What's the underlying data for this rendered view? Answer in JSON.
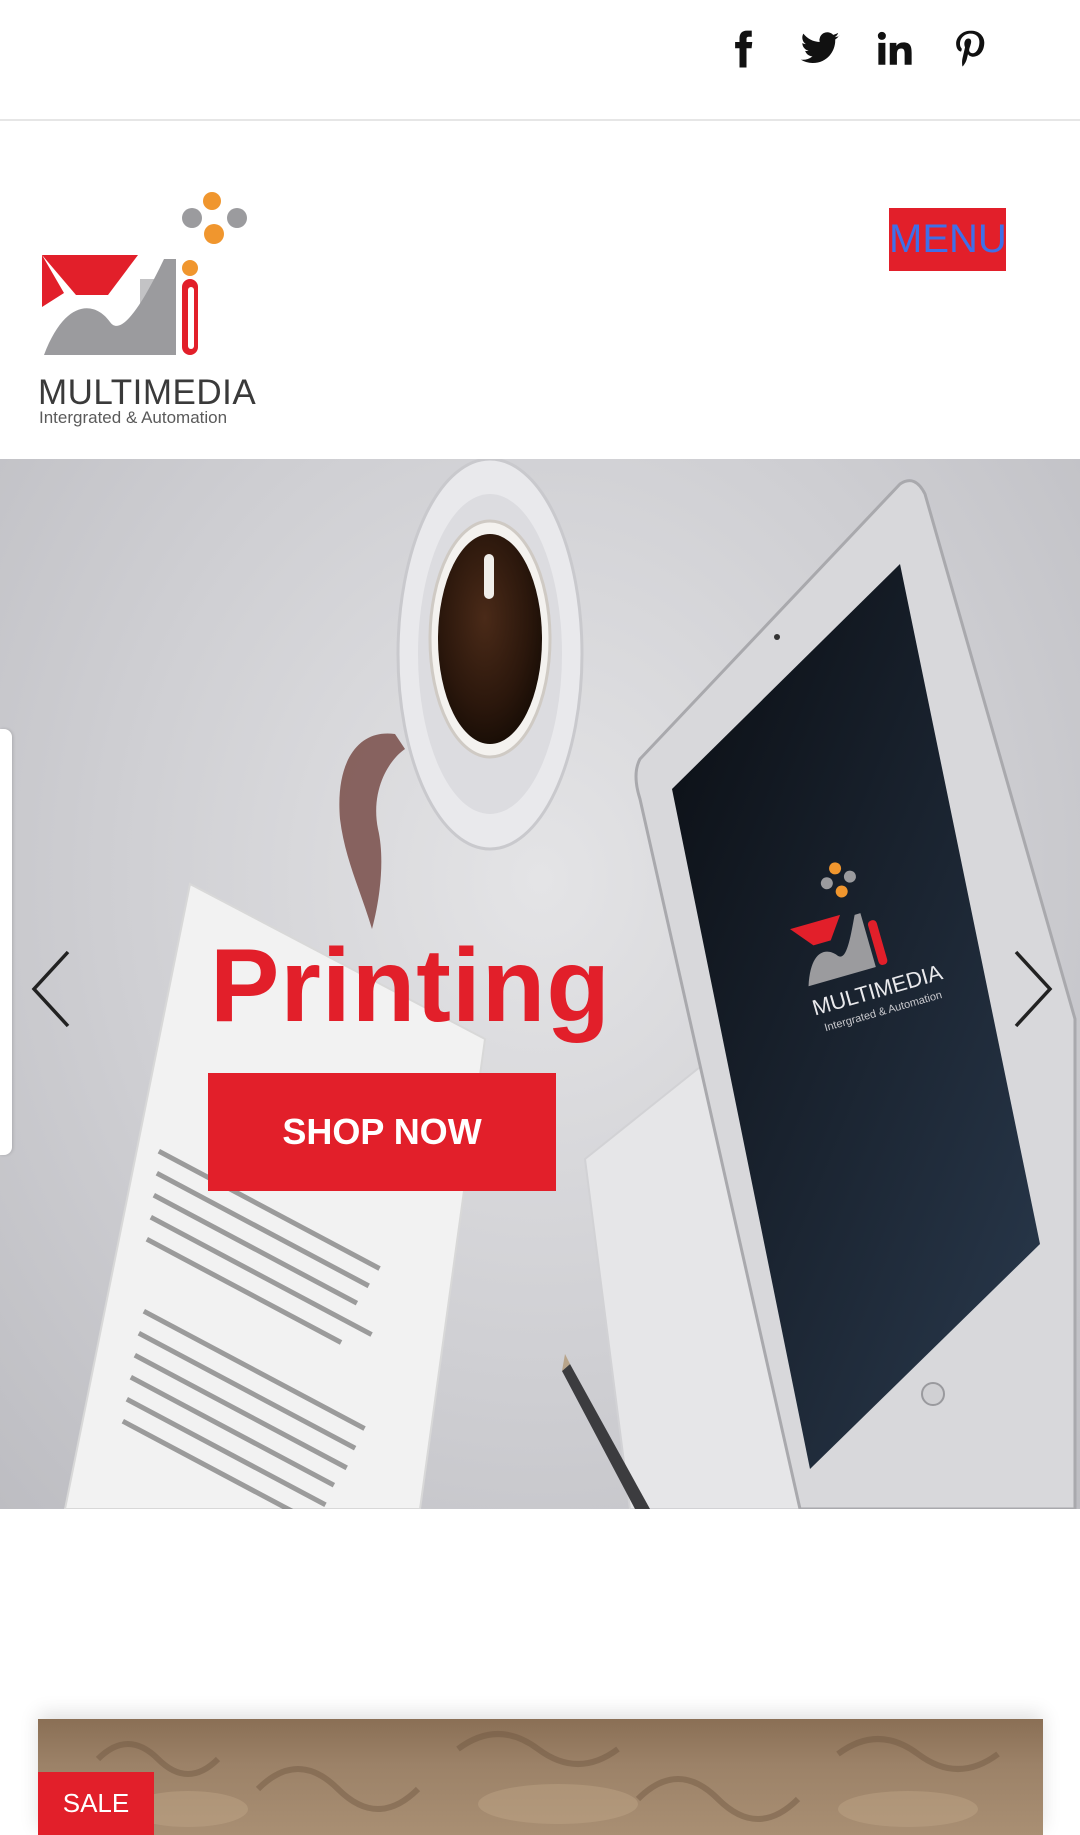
{
  "social": {
    "items": [
      {
        "name": "facebook",
        "icon": "facebook-icon"
      },
      {
        "name": "twitter",
        "icon": "twitter-icon"
      },
      {
        "name": "linkedin",
        "icon": "linkedin-icon"
      },
      {
        "name": "pinterest",
        "icon": "pinterest-icon"
      }
    ]
  },
  "header": {
    "logo": {
      "brand": "MULTIMEDIA",
      "tagline": "Intergrated & Automation"
    },
    "menu_label": "MENU"
  },
  "hero": {
    "title": "Printing",
    "cta_label": "SHOP NOW",
    "tablet_brand": "MULTIMEDIA",
    "tablet_tagline": "Intergrated & Automation"
  },
  "product": {
    "badge": "SALE"
  },
  "colors": {
    "brand_red": "#e21f2a",
    "menu_text_blue": "#3f6fe8",
    "logo_orange": "#f0962e",
    "logo_gray": "#9b9b9e"
  }
}
